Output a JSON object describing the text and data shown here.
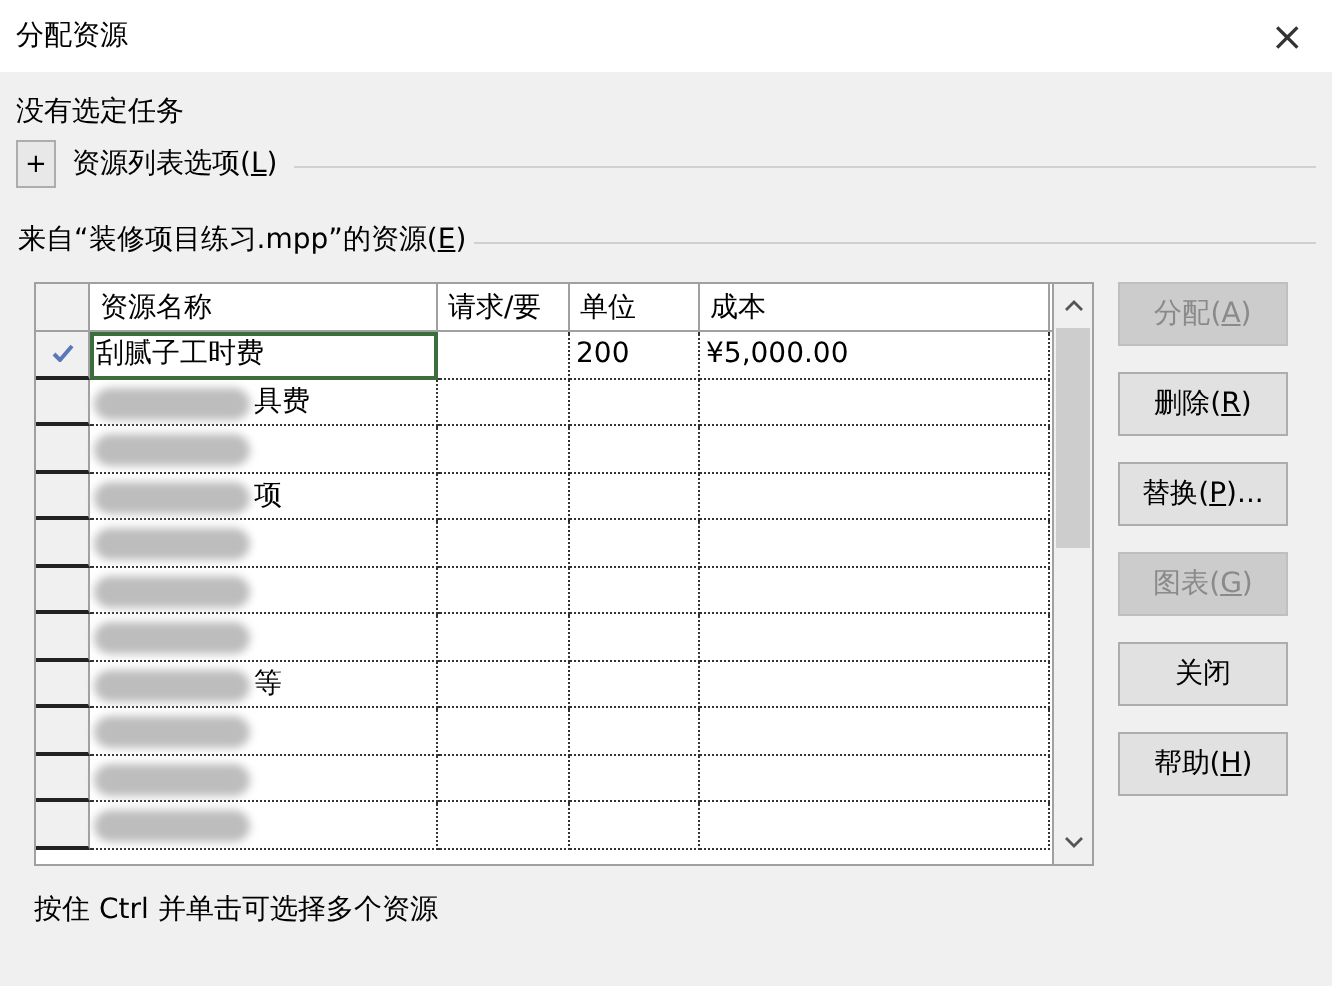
{
  "window": {
    "title": "分配资源",
    "close": "×"
  },
  "task_status": "没有选定任务",
  "options_toggle": {
    "symbol": "+",
    "label": "资源列表选项(L)"
  },
  "resources_label": "来自“装修项目练习.mpp”的资源(E)",
  "table": {
    "columns": [
      "资源名称",
      "请求/要",
      "单位",
      "成本"
    ],
    "rows": [
      {
        "checked": true,
        "selected": true,
        "redacted": false,
        "name": "刮腻子工时费",
        "units": "200",
        "cost": "¥5,000.00"
      },
      {
        "checked": false,
        "selected": false,
        "redacted": true,
        "name": "具费"
      },
      {
        "checked": false,
        "selected": false,
        "redacted": true
      },
      {
        "checked": false,
        "selected": false,
        "redacted": true,
        "name": "项"
      },
      {
        "checked": false,
        "selected": false,
        "redacted": true
      },
      {
        "checked": false,
        "selected": false,
        "redacted": true
      },
      {
        "checked": false,
        "selected": false,
        "redacted": true
      },
      {
        "checked": false,
        "selected": false,
        "redacted": true,
        "name": "等"
      },
      {
        "checked": false,
        "selected": false,
        "redacted": true
      },
      {
        "checked": false,
        "selected": false,
        "redacted": true
      },
      {
        "checked": false,
        "selected": false,
        "redacted": true
      }
    ]
  },
  "buttons": [
    {
      "label": "分配(A)",
      "disabled": true
    },
    {
      "label": "删除(R)",
      "disabled": false
    },
    {
      "label": "替换(P)...",
      "disabled": false
    },
    {
      "label": "图表(G)",
      "disabled": true
    },
    {
      "label": "关闭",
      "disabled": false
    },
    {
      "label": "帮助(H)",
      "disabled": false
    }
  ],
  "hint": "按住 Ctrl 并单击可选择多个资源"
}
